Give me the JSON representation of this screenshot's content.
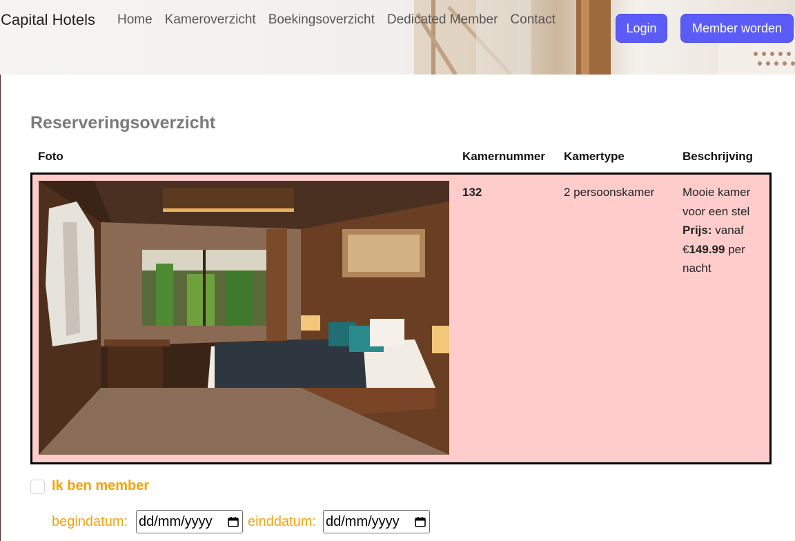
{
  "brand": "Capital Hotels",
  "nav": [
    "Home",
    "Kameroverzicht",
    "Boekingsoverzicht",
    "Dedicated Member",
    "Contact"
  ],
  "buttons": {
    "login": "Login",
    "member": "Member worden"
  },
  "colors": {
    "button": "#5b5cf7",
    "row_bg": "#ffcccc",
    "accent_label": "#f5a20a"
  },
  "section": {
    "title": "Reserveringsoverzicht"
  },
  "table": {
    "headers": {
      "photo": "Foto",
      "room_number": "Kamernummer",
      "room_type": "Kamertype",
      "description": "Beschrijving"
    },
    "row": {
      "room_number": "132",
      "room_type": "2 persoonskamer",
      "description": "Mooie kamer voor een stel",
      "price_label": "Prijs:",
      "price_from": "vanaf",
      "currency": "€",
      "price": "149.99",
      "per_night": "per nacht"
    }
  },
  "form": {
    "member_label": "Ik ben member",
    "member_checked": false,
    "start_label": "begindatum:",
    "end_label": "einddatum:",
    "date_placeholder": "dd/mm/yyyy"
  }
}
